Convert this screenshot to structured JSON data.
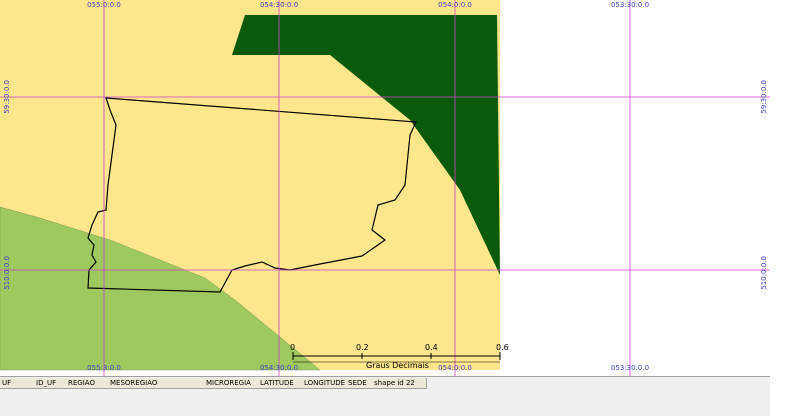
{
  "map": {
    "grid_labels": {
      "top": [
        "055:0:0.0",
        "054:30:0.0",
        "054:0:0.0",
        "053:30:0.0"
      ],
      "bottom": [
        "055:3:0.0",
        "054:30:0.0",
        "054:0:0.0",
        "053:30:0.0"
      ],
      "left": [
        "59:30:0.0",
        "510:0:0.0"
      ],
      "right": [
        "59:30:0.0",
        "510:0:0.0"
      ]
    },
    "scale_bar": {
      "ticks": [
        "0",
        "0.2",
        "0.4",
        "0.6"
      ],
      "unit": "Graus Decimais"
    },
    "colors": {
      "land": "#fde68c",
      "forest": "#0b5a0b",
      "grassland": "#9ec95e",
      "grid": "#d040d0",
      "boundary": "#000000"
    }
  },
  "table": {
    "columns": [
      "UF",
      "ID_UF",
      "REGIAO",
      "MESOREGIAO",
      "MICROREGIA",
      "LATITUDE",
      "LONGITUDE",
      "SEDE",
      "shape id 22"
    ]
  }
}
